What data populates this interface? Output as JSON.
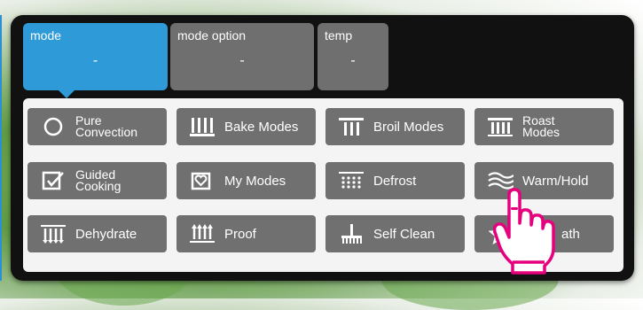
{
  "tabs": [
    {
      "label": "mode",
      "value": "-",
      "active": true
    },
    {
      "label": "mode option",
      "value": "-",
      "active": false
    },
    {
      "label": "temp",
      "value": "-",
      "active": false
    }
  ],
  "modes": [
    {
      "id": "pure-convection",
      "label_line1": "Pure",
      "label_line2": "Convection",
      "icon": "circle-icon"
    },
    {
      "id": "bake-modes",
      "label_line1": "Bake Modes",
      "label_line2": "",
      "icon": "bake-bars-icon"
    },
    {
      "id": "broil-modes",
      "label_line1": "Broil Modes",
      "label_line2": "",
      "icon": "broil-bars-icon"
    },
    {
      "id": "roast-modes",
      "label_line1": "Roast",
      "label_line2": "Modes",
      "icon": "roast-bars-icon"
    },
    {
      "id": "guided-cooking",
      "label_line1": "Guided",
      "label_line2": "Cooking",
      "icon": "checkbox-icon"
    },
    {
      "id": "my-modes",
      "label_line1": "My Modes",
      "label_line2": "",
      "icon": "heart-box-icon"
    },
    {
      "id": "defrost",
      "label_line1": "Defrost",
      "label_line2": "",
      "icon": "defrost-dots-icon"
    },
    {
      "id": "warm-hold",
      "label_line1": "Warm/Hold",
      "label_line2": "",
      "icon": "heat-waves-icon"
    },
    {
      "id": "dehydrate",
      "label_line1": "Dehydrate",
      "label_line2": "",
      "icon": "dehydrate-arrows-icon"
    },
    {
      "id": "proof",
      "label_line1": "Proof",
      "label_line2": "",
      "icon": "proof-arrows-icon"
    },
    {
      "id": "self-clean",
      "label_line1": "Self Clean",
      "label_line2": "",
      "icon": "broom-icon"
    },
    {
      "id": "bath",
      "label_line1": "ath",
      "label_line2": "",
      "icon": "star-icon"
    }
  ],
  "colors": {
    "active_tab": "#2f9ad8",
    "button": "#707070",
    "frame": "#111111",
    "pointer_hand": "#e6007e"
  }
}
